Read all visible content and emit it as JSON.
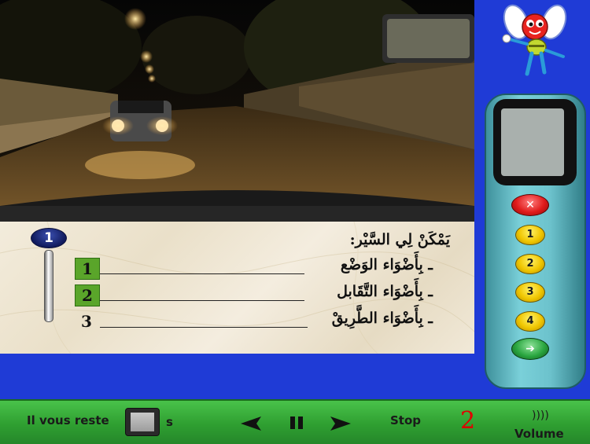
{
  "question": {
    "number": "1",
    "prompt": "يَمْكَنْ لِي السَّيْر:",
    "answers": [
      {
        "number": "1",
        "text": "ـ بِأَضْوَاء الوَضْع",
        "selected": true
      },
      {
        "number": "2",
        "text": "ـ بِأَضْوَاء التَّقَابل",
        "selected": true
      },
      {
        "number": "3",
        "text": "ـ بِأَضْوَاء الطَّرِيقْ",
        "selected": false
      }
    ]
  },
  "remote": {
    "cancel_symbol": "✕",
    "buttons": [
      "1",
      "2",
      "3",
      "4"
    ],
    "validate_symbol": "➔"
  },
  "bottom_bar": {
    "timer_label": "Il vous reste",
    "timer_unit": "s",
    "stop_label": "Stop",
    "question_counter": "2",
    "volume_label": "Volume",
    "volume_icon": "))))"
  },
  "colors": {
    "background": "#1f3bd6",
    "bottom_bar": "#3fb341",
    "selected_answer": "#5aa52a",
    "counter": "#e00000"
  }
}
